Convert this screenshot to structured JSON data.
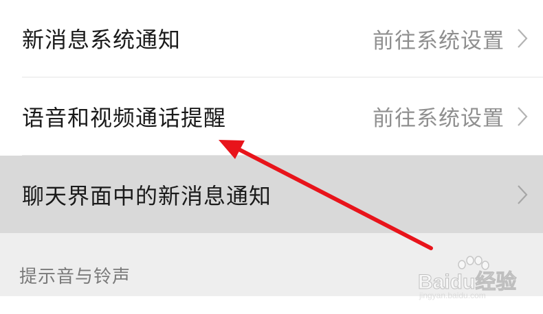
{
  "settings": {
    "items": [
      {
        "label": "新消息系统通知",
        "value": "前往系统设置"
      },
      {
        "label": "语音和视频通话提醒",
        "value": "前往系统设置"
      },
      {
        "label": "聊天界面中的新消息通知",
        "value": ""
      }
    ],
    "section_title": "提示音与铃声"
  },
  "annotation": {
    "arrow_color": "#e8141b"
  },
  "watermark": {
    "brand": "Baidu经验",
    "url": "jingyan.baidu.com"
  },
  "colors": {
    "highlight_row": "#d9d9d9",
    "section_bg": "#eeeeee",
    "secondary_text": "#8f8f8f"
  }
}
